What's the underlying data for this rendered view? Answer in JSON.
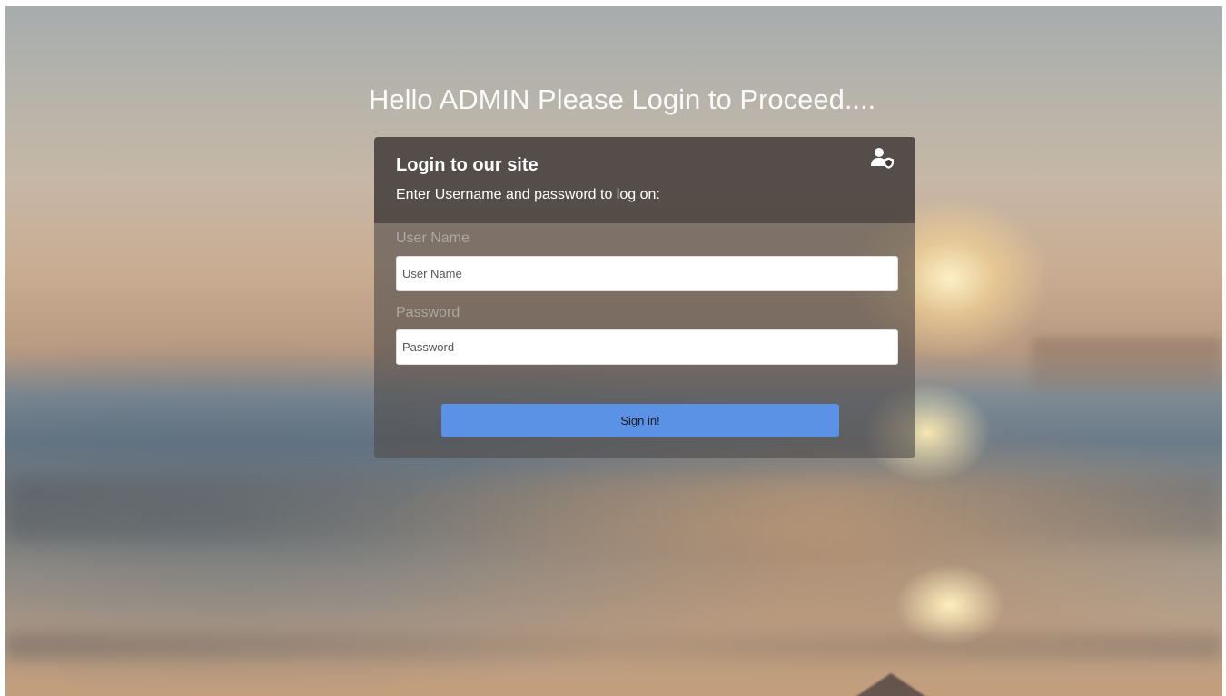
{
  "page": {
    "heading": "Hello ADMIN Please Login to Proceed....",
    "background": "blurred-sunset-beach-photo"
  },
  "login_card": {
    "title": "Login to our site",
    "subtitle": "Enter Username and password to log on:",
    "icon": "user-shield-icon",
    "username_label": "User Name",
    "username_placeholder": "User Name",
    "username_value": "",
    "password_label": "Password",
    "password_placeholder": "Password",
    "password_value": "",
    "submit_label": "Sign in!"
  },
  "colors": {
    "button": "#5b92e5",
    "card_header": "#3c3634",
    "heading_text": "#ffffff"
  }
}
